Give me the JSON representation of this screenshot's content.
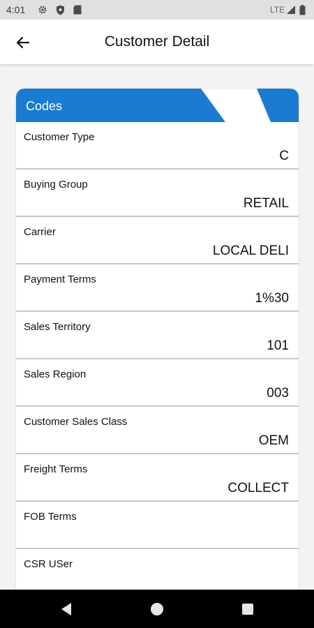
{
  "status_bar": {
    "time": "4:01",
    "icons": [
      "settings-icon",
      "shield-icon",
      "sd-card-icon"
    ],
    "network": "LTE",
    "right_icons": [
      "signal-icon",
      "battery-icon"
    ]
  },
  "app_bar": {
    "title": "Customer Detail",
    "back_icon": "arrow-left-icon"
  },
  "card": {
    "title": "Codes",
    "accent_color": "#1a7bd1",
    "fields": [
      {
        "label": "Customer Type",
        "value": "C"
      },
      {
        "label": "Buying Group",
        "value": "RETAIL"
      },
      {
        "label": "Carrier",
        "value": "LOCAL DELI"
      },
      {
        "label": "Payment Terms",
        "value": "1%30"
      },
      {
        "label": "Sales Territory",
        "value": "101"
      },
      {
        "label": "Sales Region",
        "value": "003"
      },
      {
        "label": "Customer Sales Class",
        "value": "OEM"
      },
      {
        "label": "Freight Terms",
        "value": "COLLECT"
      },
      {
        "label": "FOB Terms",
        "value": ""
      },
      {
        "label": "CSR USer",
        "value": ""
      }
    ]
  },
  "nav_bar": {
    "buttons": [
      "back-triangle-icon",
      "home-circle-icon",
      "recents-square-icon"
    ]
  }
}
